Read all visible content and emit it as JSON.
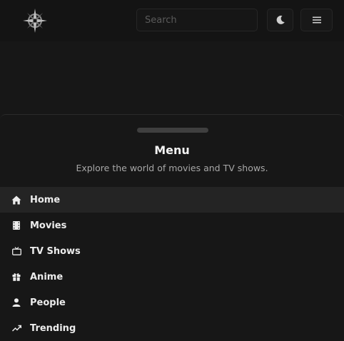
{
  "header": {
    "logo": "compass-star-logo",
    "search": {
      "placeholder": "Search",
      "value": ""
    },
    "theme_icon": "moon-icon",
    "menu_icon": "hamburger-icon"
  },
  "menu": {
    "title": "Menu",
    "description": "Explore the world of movies and TV shows.",
    "items": [
      {
        "label": "Home",
        "icon": "home-icon",
        "active": true
      },
      {
        "label": "Movies",
        "icon": "film-icon",
        "active": false
      },
      {
        "label": "TV Shows",
        "icon": "tv-icon",
        "active": false
      },
      {
        "label": "Anime",
        "icon": "gift-icon",
        "active": false
      },
      {
        "label": "People",
        "icon": "user-icon",
        "active": false
      },
      {
        "label": "Trending",
        "icon": "trending-icon",
        "active": false
      }
    ]
  },
  "colors": {
    "background": "#171717",
    "active_item": "#242424",
    "text": "#ececec",
    "muted_text": "#a7a7a7"
  }
}
